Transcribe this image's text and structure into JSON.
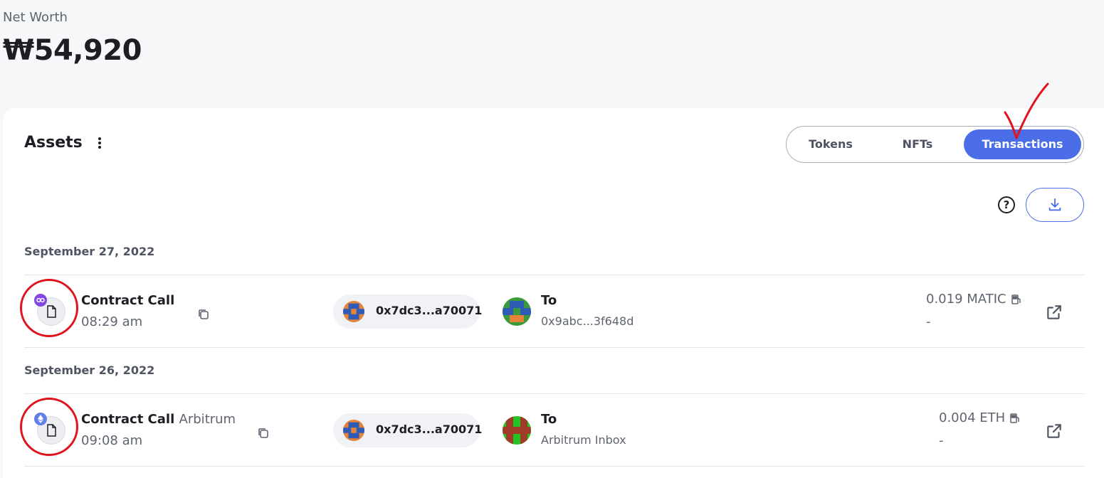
{
  "header": {
    "net_worth_label": "Net Worth",
    "net_worth_value": "₩54,920"
  },
  "assets": {
    "title": "Assets",
    "menu_icon": "kebab-vertical-icon"
  },
  "tabs": [
    {
      "label": "Tokens",
      "active": false
    },
    {
      "label": "NFTs",
      "active": false
    },
    {
      "label": "Transactions",
      "active": true
    }
  ],
  "toolbar": {
    "help_label": "?",
    "help_icon": "question-circle-icon",
    "download_icon": "download-icon"
  },
  "groups": [
    {
      "date": "September 27, 2022",
      "transactions": [
        {
          "type": "Contract Call",
          "network": "",
          "time": "08:29 am",
          "chain_icon": "polygon-icon",
          "from_address": "0x7dc3...a70071",
          "to_label": "To",
          "to_address": "0x9abc...3f648d",
          "amount": "0.019 MATIC",
          "amount_sub": "-"
        }
      ]
    },
    {
      "date": "September 26, 2022",
      "transactions": [
        {
          "type": "Contract Call",
          "network": "Arbitrum",
          "time": "09:08 am",
          "chain_icon": "ethereum-icon",
          "from_address": "0x7dc3...a70071",
          "to_label": "To",
          "to_address": "Arbitrum Inbox",
          "amount": "0.004 ETH",
          "amount_sub": "-"
        }
      ]
    }
  ],
  "colors": {
    "accent": "#4b6ee8",
    "annotation": "#e0141e",
    "polygon": "#8247e5",
    "ethereum": "#627eea"
  }
}
